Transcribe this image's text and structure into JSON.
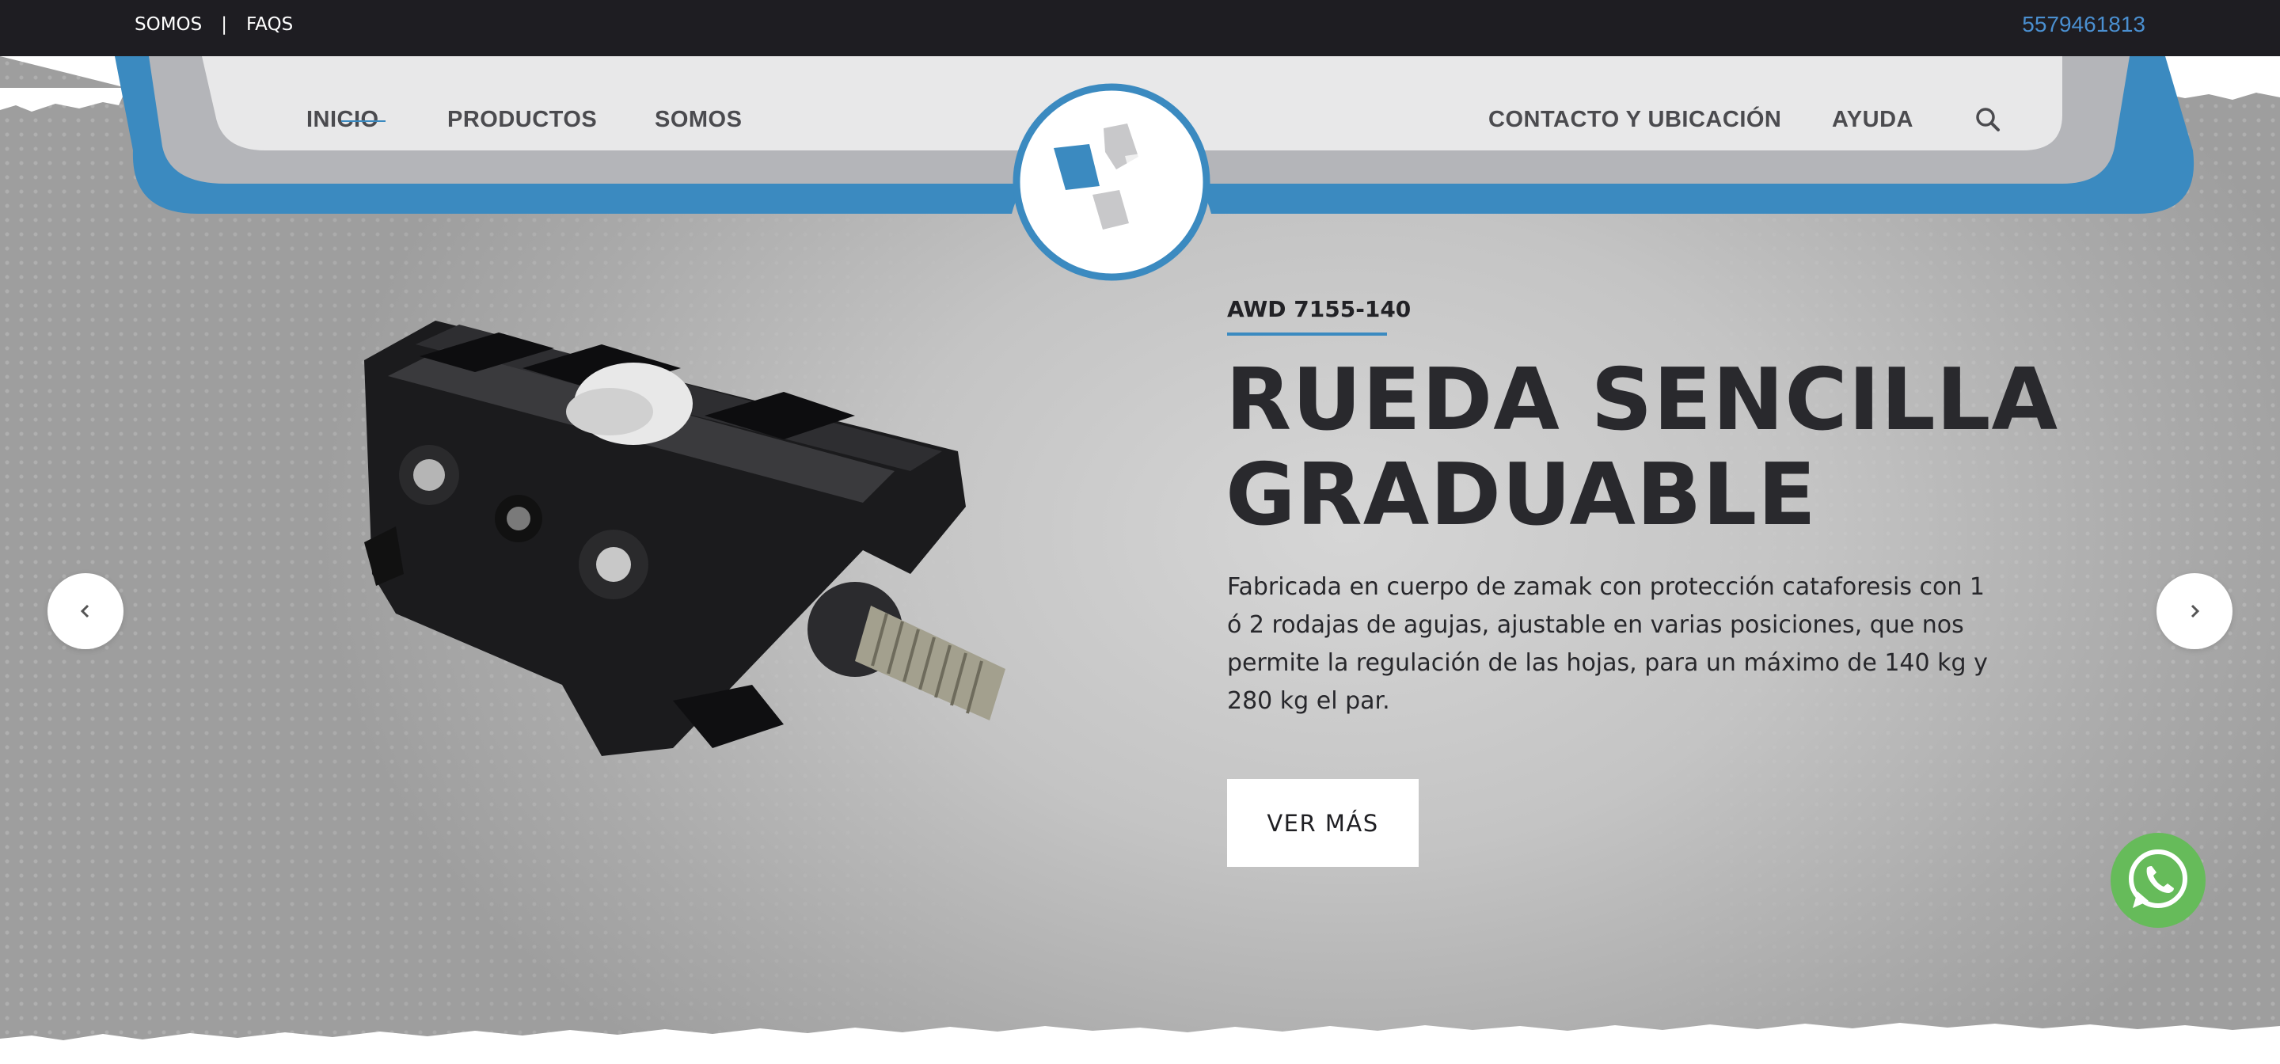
{
  "topbar": {
    "links": [
      "SOMOS",
      "FAQS"
    ],
    "separator": "|",
    "phone": "5579461813"
  },
  "nav": {
    "left": [
      "INICIO",
      "PRODUCTOS",
      "SOMOS"
    ],
    "right": [
      "CONTACTO Y UBICACIÓN",
      "AYUDA"
    ],
    "active": "INICIO",
    "search_icon": "search-icon"
  },
  "slide": {
    "code": "AWD 7155-140",
    "title_line1": "RUEDA SENCILLA",
    "title_line2": "GRADUABLE",
    "description": "Fabricada en cuerpo de zamak con protección cataforesis con 1 ó 2 rodajas de agujas, ajustable en varias posiciones, que nos permite la regulación de las hojas, para un máximo de 140 kg y 280 kg el par.",
    "button": "VER MÁS",
    "prev_icon": "chevron-left-icon",
    "next_icon": "chevron-right-icon"
  },
  "colors": {
    "topbar_bg": "#1e1d22",
    "accent": "#3b8ac0",
    "phone": "#4a8fd0",
    "nav_text": "#4b4b4f",
    "title_text": "#29292d",
    "whatsapp": "#66bb5a"
  },
  "floating": {
    "icon": "whatsapp-icon"
  }
}
